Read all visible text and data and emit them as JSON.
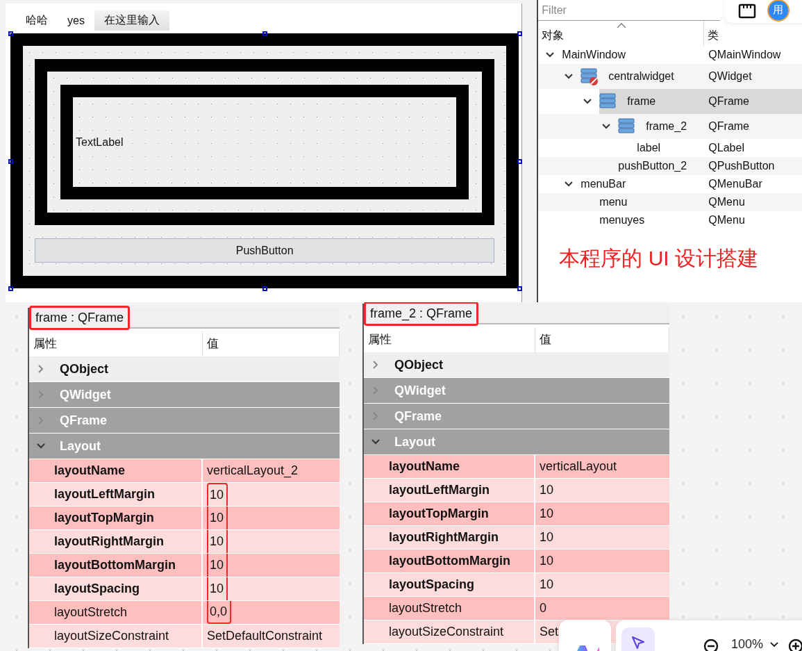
{
  "designer": {
    "menu": [
      {
        "label": "哈哈",
        "kind": "item"
      },
      {
        "label": "yes",
        "kind": "item"
      },
      {
        "label": "在这里输入",
        "kind": "placeholder"
      }
    ],
    "text_label": "TextLabel",
    "push_button": "PushButton"
  },
  "account": {
    "avatar": "用"
  },
  "object_inspector": {
    "filter": {
      "placeholder": "Filter"
    },
    "columns": [
      "对象",
      "类"
    ],
    "tree": [
      {
        "name": "MainWindow",
        "class": "QMainWindow",
        "expanded": true,
        "selected": false,
        "children": [
          {
            "name": "centralwidget",
            "class": "QWidget",
            "kind": "broken-layout",
            "expanded": true,
            "selected": false,
            "children": [
              {
                "name": "frame",
                "class": "QFrame",
                "kind": "vertical-layout",
                "expanded": true,
                "selected": true,
                "children": [
                  {
                    "name": "frame_2",
                    "class": "QFrame",
                    "kind": "vertical-layout",
                    "expanded": true,
                    "selected": false,
                    "children": [
                      {
                        "name": "label",
                        "class": "QLabel",
                        "selected": false
                      }
                    ]
                  },
                  {
                    "name": "pushButton_2",
                    "class": "QPushButton",
                    "selected": false
                  }
                ]
              }
            ]
          },
          {
            "name": "menuBar",
            "class": "QMenuBar",
            "expanded": true,
            "selected": false,
            "children": [
              {
                "name": "menu",
                "class": "QMenu",
                "selected": false
              },
              {
                "name": "menuyes",
                "class": "QMenu",
                "selected": false
              }
            ]
          }
        ]
      }
    ]
  },
  "annotation": "本程序的 UI 设计搭建",
  "property_panels": [
    {
      "title": "frame : QFrame",
      "title_outlined": true,
      "columns": [
        "属性",
        "值"
      ],
      "rows": [
        {
          "kind": "group-light",
          "label": "QObject",
          "expanded": false
        },
        {
          "kind": "group-dark",
          "label": "QWidget",
          "expanded": false
        },
        {
          "kind": "group-dark",
          "label": "QFrame",
          "expanded": false
        },
        {
          "kind": "group-dark",
          "label": "Layout",
          "expanded": true
        },
        {
          "kind": "property",
          "name": "layoutName",
          "value": "verticalLayout_2",
          "modified": true,
          "outlined": false
        },
        {
          "kind": "property",
          "name": "layoutLeftMargin",
          "value": "10",
          "modified": true,
          "outlined": true
        },
        {
          "kind": "property",
          "name": "layoutTopMargin",
          "value": "10",
          "modified": true,
          "outlined": true
        },
        {
          "kind": "property",
          "name": "layoutRightMargin",
          "value": "10",
          "modified": true,
          "outlined": true
        },
        {
          "kind": "property",
          "name": "layoutBottomMargin",
          "value": "10",
          "modified": true,
          "outlined": true
        },
        {
          "kind": "property",
          "name": "layoutSpacing",
          "value": "10",
          "modified": true,
          "outlined": true
        },
        {
          "kind": "property",
          "name": "layoutStretch",
          "value": "0,0",
          "modified": false,
          "outlined": true
        },
        {
          "kind": "property",
          "name": "layoutSizeConstraint",
          "value": "SetDefaultConstraint",
          "modified": false,
          "outlined": false
        }
      ]
    },
    {
      "title": "frame_2 : QFrame",
      "title_outlined": true,
      "columns": [
        "属性",
        "值"
      ],
      "rows": [
        {
          "kind": "group-light",
          "label": "QObject",
          "expanded": false
        },
        {
          "kind": "group-dark",
          "label": "QWidget",
          "expanded": false
        },
        {
          "kind": "group-dark",
          "label": "QFrame",
          "expanded": false
        },
        {
          "kind": "group-dark",
          "label": "Layout",
          "expanded": true
        },
        {
          "kind": "property",
          "name": "layoutName",
          "value": "verticalLayout",
          "modified": true,
          "outlined": false
        },
        {
          "kind": "property",
          "name": "layoutLeftMargin",
          "value": "10",
          "modified": true,
          "outlined": false
        },
        {
          "kind": "property",
          "name": "layoutTopMargin",
          "value": "10",
          "modified": true,
          "outlined": false
        },
        {
          "kind": "property",
          "name": "layoutRightMargin",
          "value": "10",
          "modified": true,
          "outlined": false
        },
        {
          "kind": "property",
          "name": "layoutBottomMargin",
          "value": "10",
          "modified": true,
          "outlined": false
        },
        {
          "kind": "property",
          "name": "layoutSpacing",
          "value": "10",
          "modified": true,
          "outlined": false
        },
        {
          "kind": "property",
          "name": "layoutStretch",
          "value": "0",
          "modified": false,
          "outlined": false
        },
        {
          "kind": "property",
          "name": "layoutSizeConstraint",
          "value": "Set",
          "modified": false,
          "outlined": false
        }
      ]
    }
  ],
  "toolbar": {
    "zoom": "100%"
  }
}
